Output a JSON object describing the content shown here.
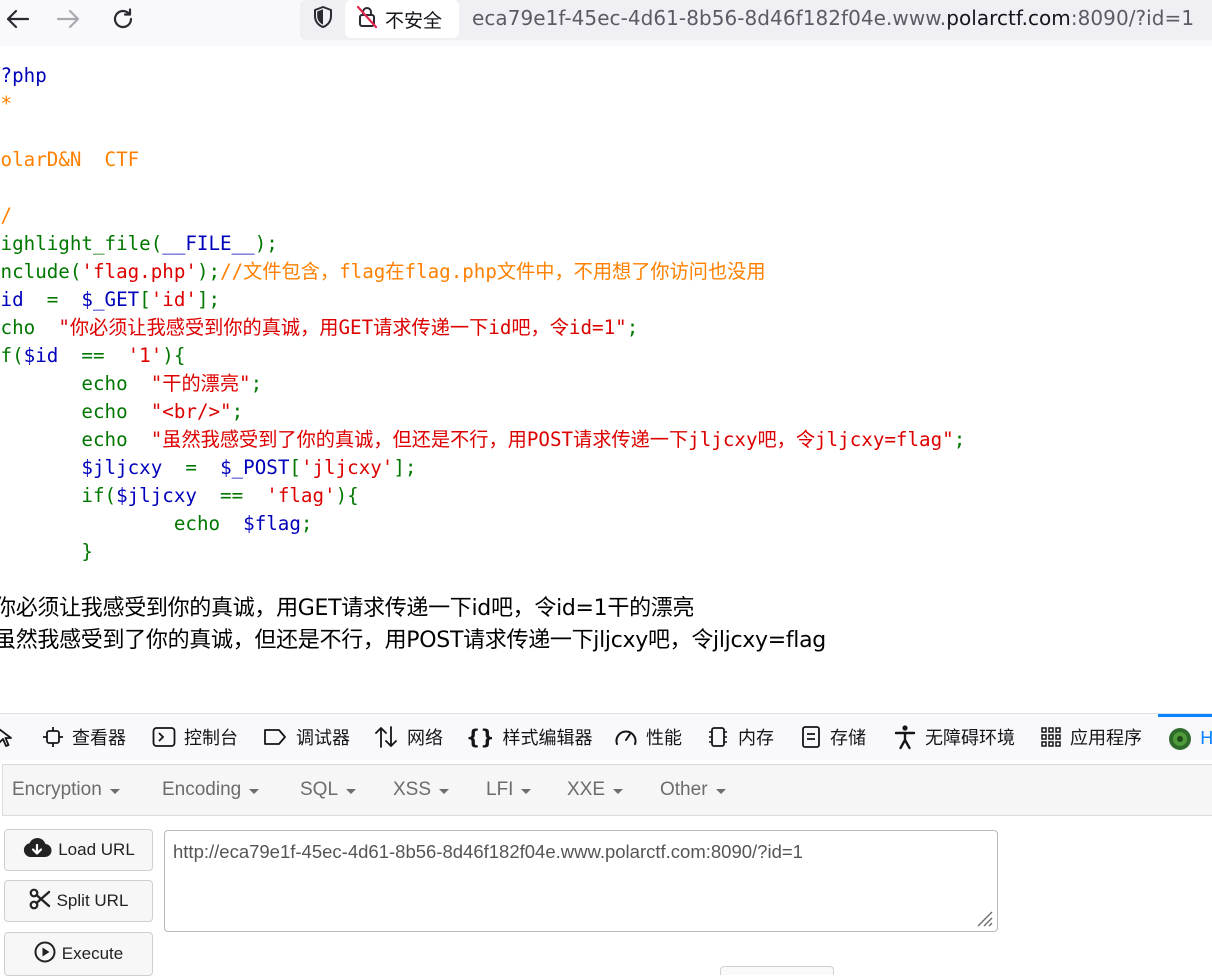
{
  "browser": {
    "security_label": "不安全",
    "url_prefix": "eca79e1f-45ec-4d61-8b56-8d46f182f04e.www.",
    "url_host": "polarctf.com",
    "url_suffix": ":8090/?id=1",
    "icons": [
      "back-arrow-icon",
      "forward-arrow-icon",
      "reload-icon",
      "shield-icon",
      "insecure-lock-icon"
    ]
  },
  "source": {
    "open_tag": "<?php",
    "comment_open": "/*",
    "comment_title": "PolarD&N  CTF",
    "comment_close": "*/",
    "line_highlight_fn": "highlight_file(",
    "line_highlight_const": "__FILE__",
    "line_highlight_end": ");",
    "line_include_kw": "include(",
    "line_include_str": "'flag.php'",
    "line_include_end": ");",
    "line_include_comment": "//文件包含，flag在flag.php文件中，不用想了你访问也没用",
    "line_id_var": "$id",
    "line_id_eq": "  =  ",
    "line_id_get": "$_GET",
    "line_id_bracket": "[",
    "line_id_key": "'id'",
    "line_id_end": "];",
    "line_echo1_kw": "echo  ",
    "line_echo1_str": "\"你必须让我感受到你的真诚，用GET请求传递一下id吧，令id=1\"",
    "line_echo1_end": ";",
    "line_if1_kw": "if(",
    "line_if1_var": "$id",
    "line_if1_op": "  ==  ",
    "line_if1_str": "'1'",
    "line_if1_end": "){",
    "line_echo2_kw": "echo  ",
    "line_echo2_str": "\"干的漂亮\"",
    "line_echo2_end": ";",
    "line_echo3_kw": "echo  ",
    "line_echo3_str": "\"<br/>\"",
    "line_echo3_end": ";",
    "line_echo4_kw": "echo  ",
    "line_echo4_str": "\"虽然我感受到了你的真诚，但还是不行，用POST请求传递一下jljcxy吧，令jljcxy=flag\"",
    "line_echo4_end": ";",
    "line_post_var": "$jljcxy",
    "line_post_eq": "  =  ",
    "line_post_fn": "$_POST",
    "line_post_bracket": "[",
    "line_post_key": "'jljcxy'",
    "line_post_end": "];",
    "line_if2_kw": "if(",
    "line_if2_var": "$jljcxy",
    "line_if2_op": "  ==  ",
    "line_if2_str": "'flag'",
    "line_if2_end": "){",
    "line_echo5_kw": "echo  ",
    "line_echo5_var": "$flag",
    "line_echo5_end": ";",
    "line_close_brace": "}"
  },
  "output": {
    "line1": "你必须让我感受到你的真诚，用GET请求传递一下id吧，令id=1干的漂亮",
    "line2": "虽然我感受到了你的真诚，但还是不行，用POST请求传递一下jljcxy吧，令jljcxy=flag"
  },
  "devtools": {
    "tabs": [
      {
        "label": "查看器",
        "icon": "inspector-icon"
      },
      {
        "label": "控制台",
        "icon": "console-icon"
      },
      {
        "label": "调试器",
        "icon": "debugger-icon"
      },
      {
        "label": "网络",
        "icon": "network-icon"
      },
      {
        "label": "样式编辑器",
        "icon": "style-editor-icon"
      },
      {
        "label": "性能",
        "icon": "performance-icon"
      },
      {
        "label": "内存",
        "icon": "memory-icon"
      },
      {
        "label": "存储",
        "icon": "storage-icon"
      },
      {
        "label": "无障碍环境",
        "icon": "accessibility-icon"
      },
      {
        "label": "应用程序",
        "icon": "application-icon"
      },
      {
        "label": "H",
        "icon": "hackbar-icon"
      }
    ]
  },
  "hackbar": {
    "menus": [
      "Encryption",
      "Encoding",
      "SQL",
      "XSS",
      "LFI",
      "XXE",
      "Other"
    ],
    "buttons": {
      "load_url": "Load URL",
      "split_url": "Split URL",
      "execute": "Execute"
    },
    "url_value": "http://eca79e1f-45ec-4d61-8b56-8d46f182f04e.www.polarctf.com:8090/?id=1"
  },
  "colors": {
    "php_html": "#000000",
    "php_keyword": "#007700",
    "php_string": "#dd0000",
    "php_comment": "#ff8000",
    "php_default": "#0000bb",
    "devtools_active": "#0a84ff"
  }
}
